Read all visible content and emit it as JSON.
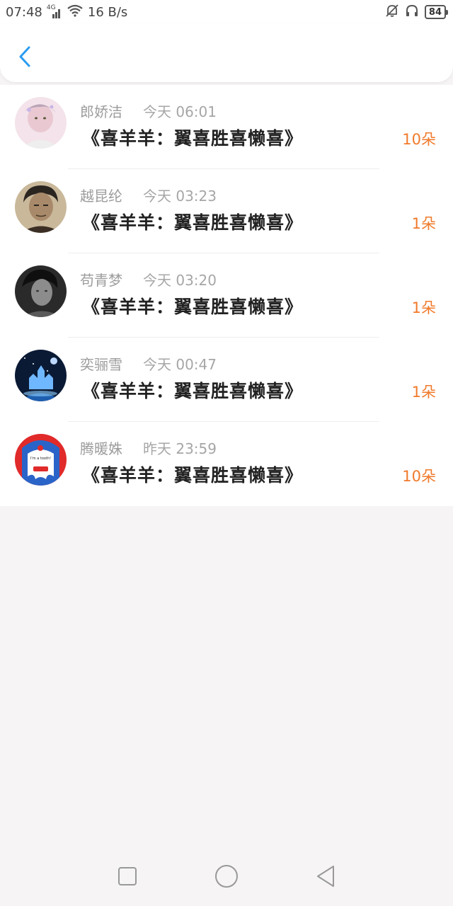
{
  "status_bar": {
    "time": "07:48",
    "network": "4G",
    "speed": "16 B/s",
    "battery": "84"
  },
  "header": {
    "back_icon": "chevron-left-icon",
    "accent_color": "#2b9cf0"
  },
  "gifts": [
    {
      "name": "郎娇洁",
      "time": "今天 06:01",
      "gift": "《喜羊羊：翼喜胜喜懒喜》",
      "count": "10朵"
    },
    {
      "name": "越昆纶",
      "time": "今天 03:23",
      "gift": "《喜羊羊：翼喜胜喜懒喜》",
      "count": "1朵"
    },
    {
      "name": "苟青梦",
      "time": "今天 03:20",
      "gift": "《喜羊羊：翼喜胜喜懒喜》",
      "count": "1朵"
    },
    {
      "name": "奕骊雪",
      "time": "今天 00:47",
      "gift": "《喜羊羊：翼喜胜喜懒喜》",
      "count": "1朵"
    },
    {
      "name": "腾暖姝",
      "time": "昨天 23:59",
      "gift": "《喜羊羊：翼喜胜喜懒喜》",
      "count": "10朵"
    }
  ],
  "avatar_badge_text": "I'm a tooth!",
  "colors": {
    "count": "#f07a2b",
    "name": "#9c9c9c",
    "background": "#f6f4f5"
  },
  "nav": {
    "recent_icon": "square-icon",
    "home_icon": "circle-icon",
    "back_icon": "triangle-back-icon"
  }
}
